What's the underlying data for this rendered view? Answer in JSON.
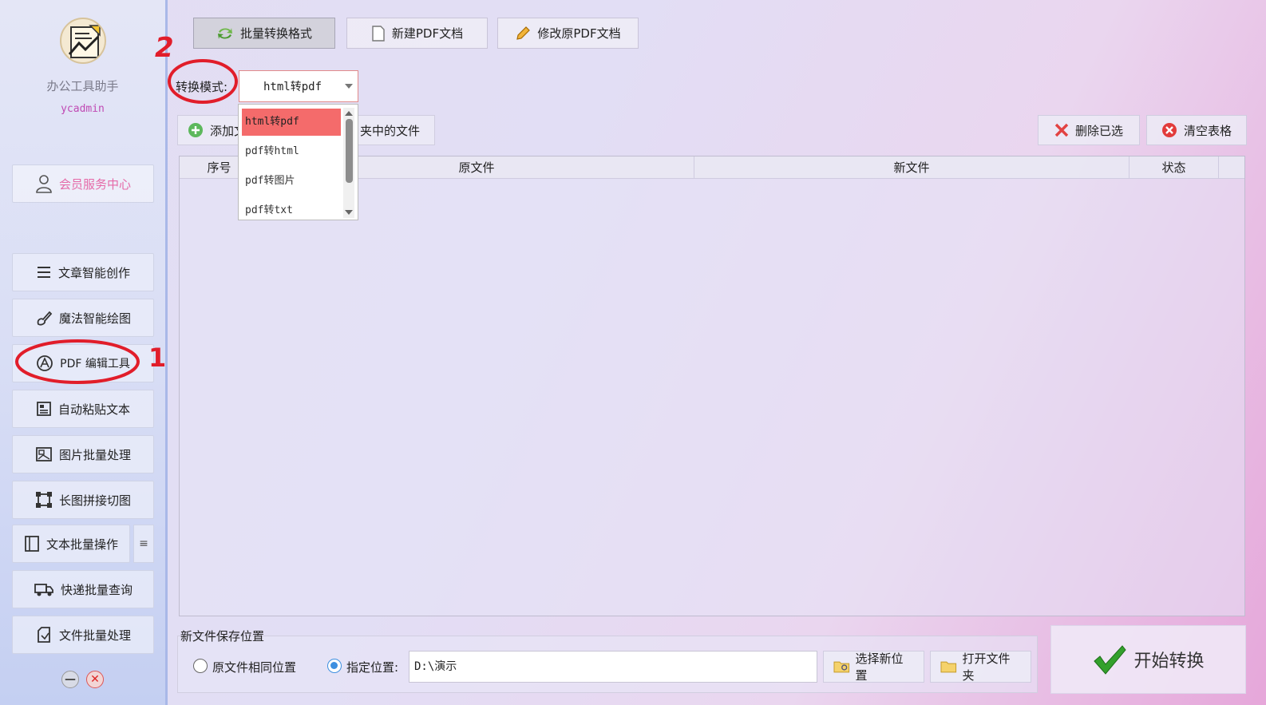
{
  "app": {
    "name": "办公工具助手",
    "user": "ycadmin"
  },
  "sidebar": {
    "member": "会员服务中心",
    "items": [
      {
        "label": "文章智能创作",
        "icon": "list-icon"
      },
      {
        "label": "魔法智能绘图",
        "icon": "brush-icon"
      },
      {
        "label": "PDF 编辑工具",
        "icon": "pdf-icon"
      },
      {
        "label": "自动粘贴文本",
        "icon": "paste-icon"
      },
      {
        "label": "图片批量处理",
        "icon": "image-icon"
      },
      {
        "label": "长图拼接切图",
        "icon": "crop-icon"
      },
      {
        "label": "文本批量操作",
        "icon": "text-batch-icon"
      },
      {
        "label": "快递批量查询",
        "icon": "truck-icon"
      },
      {
        "label": "文件批量处理",
        "icon": "file-icon"
      }
    ],
    "menu_glyph": "≡"
  },
  "tabs": [
    {
      "label": "批量转换格式",
      "active": true
    },
    {
      "label": "新建PDF文档",
      "active": false
    },
    {
      "label": "修改原PDF文档",
      "active": false
    }
  ],
  "mode": {
    "label": "转换模式:",
    "value": "html转pdf",
    "options": [
      "html转pdf",
      "pdf转html",
      "pdf转图片",
      "pdf转txt"
    ]
  },
  "toolbar": {
    "add_files_partial": "添加文",
    "add_folder_partial": "夹中的文件",
    "delete_selected": "删除已选",
    "clear_table": "清空表格"
  },
  "table": {
    "columns": [
      "序号",
      "原文件",
      "新文件",
      "状态"
    ],
    "rows": []
  },
  "save": {
    "title": "新文件保存位置",
    "option_same": "原文件相同位置",
    "option_custom": "指定位置:",
    "path": "D:\\演示",
    "select_new": "选择新位置",
    "open_folder": "打开文件夹",
    "selected": "custom"
  },
  "start_label": "开始转换",
  "annotations": {
    "one": "1",
    "two": "2"
  },
  "colors": {
    "accent": "#f46b6b",
    "member_text": "#e56aa8",
    "user_text": "#c04ab4",
    "radio": "#3d8fe0",
    "check": "#33a02c"
  }
}
